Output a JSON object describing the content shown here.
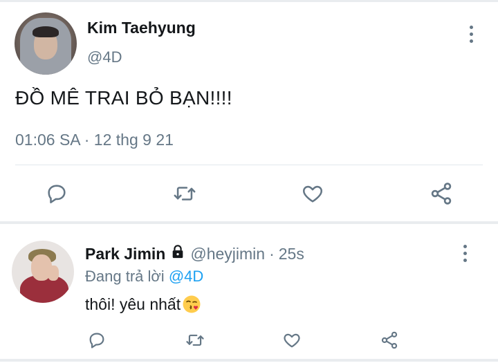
{
  "main_tweet": {
    "name": "Kim Taehyung",
    "handle": "@4D",
    "text": "ĐỒ MÊ TRAI BỎ BẠN!!!!",
    "timestamp": "01:06 SA · 12 thg 9 21",
    "actions": [
      "reply-icon",
      "retweet-icon",
      "like-icon",
      "share-icon"
    ]
  },
  "reply": {
    "name": "Park Jimin",
    "handle": "@heyjimin",
    "separator": "·",
    "time": "25s",
    "replying_label": "Đang trả lời",
    "replying_to": "@4D",
    "text": "thôi! yêu nhất",
    "emoji": "face-blowing-kiss"
  },
  "colors": {
    "text": "#14171a",
    "secondary": "#657786",
    "link": "#1da1f2",
    "divider": "#e1e8ed"
  }
}
